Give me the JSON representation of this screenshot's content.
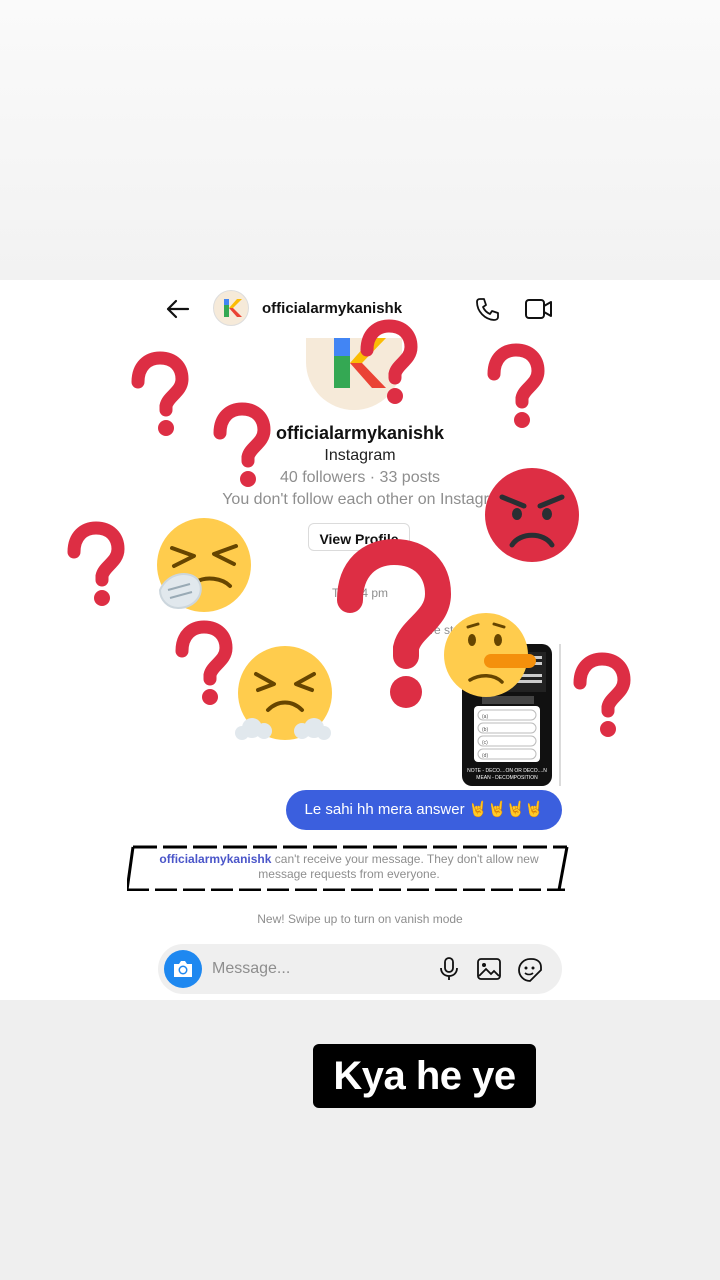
{
  "header": {
    "username": "officialarmykanishk",
    "avatar_letter": "K"
  },
  "profile": {
    "name": "officialarmykanishk",
    "subtitle": "Instagram",
    "stats": "40 followers · 33 posts",
    "follow_status": "You don't follow each other on Instagra",
    "view_button": "View Profile"
  },
  "chat": {
    "timestamp": "Toda      4 pm",
    "replied_label": "re        story",
    "story_lines": [
      "NOTE - DECO....ON OR DECO....N",
      "MEAN - DECOMPOSITION"
    ],
    "story_options": [
      "(a)",
      "(b)",
      "(c)",
      "(d)"
    ],
    "message": "Le sahi hh mera answer 🤘🤘🤘🤘",
    "notice_user": "officialarmykanishk",
    "notice_text": "can't receive your message. They don't allow new message requests from everyone.",
    "vanish_hint": "New! Swipe up to turn on vanish mode"
  },
  "composer": {
    "placeholder": "Message..."
  },
  "overlay": {
    "caption": "Kya he ye"
  },
  "colors": {
    "bubble": "#3b5fde",
    "question_mark": "#dd2e44",
    "emoji_yellow": "#ffcc4d",
    "angry_red": "#dd2e44",
    "camera": "#1e88f0"
  }
}
